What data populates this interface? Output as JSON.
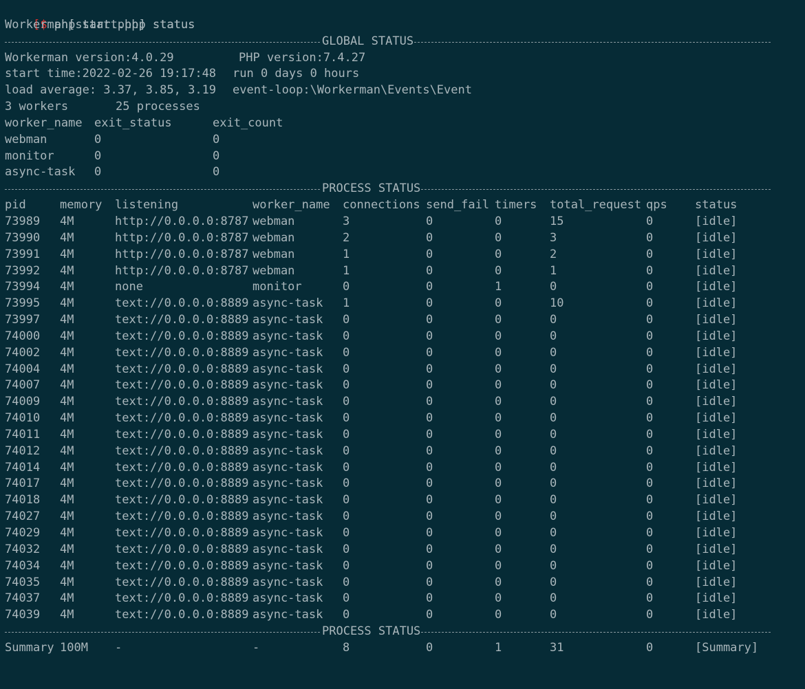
{
  "terminal": {
    "prompt_symbol": "$",
    "command": "php start.php status",
    "subtitle": "Workerman[start.php] status"
  },
  "global": {
    "section_title": "GLOBAL STATUS",
    "workerman_version": "Workerman version:4.0.29",
    "php_version": "PHP version:7.4.27",
    "start_time": "start time:2022-02-26 19:17:48",
    "run_time": "run 0 days 0 hours",
    "load_average": "load average: 3.37, 3.85, 3.19",
    "event_loop": "event-loop:\\Workerman\\Events\\Event",
    "workers": "3 workers",
    "processes": "25 processes",
    "worker_columns": [
      "worker_name",
      "exit_status",
      "exit_count"
    ],
    "worker_rows": [
      [
        "webman",
        "0",
        "0"
      ],
      [
        "monitor",
        "0",
        "0"
      ],
      [
        "async-task",
        "0",
        "0"
      ]
    ]
  },
  "process": {
    "section_title": "PROCESS STATUS",
    "columns": [
      "pid",
      "memory",
      "listening",
      "worker_name",
      "connections",
      "send_fail",
      "timers",
      "total_request",
      "qps",
      "status"
    ],
    "rows": [
      [
        "73989",
        "4M",
        "http://0.0.0.0:8787",
        "webman",
        "3",
        "0",
        "0",
        "15",
        "0",
        "[idle]"
      ],
      [
        "73990",
        "4M",
        "http://0.0.0.0:8787",
        "webman",
        "2",
        "0",
        "0",
        "3",
        "0",
        "[idle]"
      ],
      [
        "73991",
        "4M",
        "http://0.0.0.0:8787",
        "webman",
        "1",
        "0",
        "0",
        "2",
        "0",
        "[idle]"
      ],
      [
        "73992",
        "4M",
        "http://0.0.0.0:8787",
        "webman",
        "1",
        "0",
        "0",
        "1",
        "0",
        "[idle]"
      ],
      [
        "73994",
        "4M",
        "none",
        "monitor",
        "0",
        "0",
        "1",
        "0",
        "0",
        "[idle]"
      ],
      [
        "73995",
        "4M",
        "text://0.0.0.0:8889",
        "async-task",
        "1",
        "0",
        "0",
        "10",
        "0",
        "[idle]"
      ],
      [
        "73997",
        "4M",
        "text://0.0.0.0:8889",
        "async-task",
        "0",
        "0",
        "0",
        "0",
        "0",
        "[idle]"
      ],
      [
        "74000",
        "4M",
        "text://0.0.0.0:8889",
        "async-task",
        "0",
        "0",
        "0",
        "0",
        "0",
        "[idle]"
      ],
      [
        "74002",
        "4M",
        "text://0.0.0.0:8889",
        "async-task",
        "0",
        "0",
        "0",
        "0",
        "0",
        "[idle]"
      ],
      [
        "74004",
        "4M",
        "text://0.0.0.0:8889",
        "async-task",
        "0",
        "0",
        "0",
        "0",
        "0",
        "[idle]"
      ],
      [
        "74007",
        "4M",
        "text://0.0.0.0:8889",
        "async-task",
        "0",
        "0",
        "0",
        "0",
        "0",
        "[idle]"
      ],
      [
        "74009",
        "4M",
        "text://0.0.0.0:8889",
        "async-task",
        "0",
        "0",
        "0",
        "0",
        "0",
        "[idle]"
      ],
      [
        "74010",
        "4M",
        "text://0.0.0.0:8889",
        "async-task",
        "0",
        "0",
        "0",
        "0",
        "0",
        "[idle]"
      ],
      [
        "74011",
        "4M",
        "text://0.0.0.0:8889",
        "async-task",
        "0",
        "0",
        "0",
        "0",
        "0",
        "[idle]"
      ],
      [
        "74012",
        "4M",
        "text://0.0.0.0:8889",
        "async-task",
        "0",
        "0",
        "0",
        "0",
        "0",
        "[idle]"
      ],
      [
        "74014",
        "4M",
        "text://0.0.0.0:8889",
        "async-task",
        "0",
        "0",
        "0",
        "0",
        "0",
        "[idle]"
      ],
      [
        "74017",
        "4M",
        "text://0.0.0.0:8889",
        "async-task",
        "0",
        "0",
        "0",
        "0",
        "0",
        "[idle]"
      ],
      [
        "74018",
        "4M",
        "text://0.0.0.0:8889",
        "async-task",
        "0",
        "0",
        "0",
        "0",
        "0",
        "[idle]"
      ],
      [
        "74027",
        "4M",
        "text://0.0.0.0:8889",
        "async-task",
        "0",
        "0",
        "0",
        "0",
        "0",
        "[idle]"
      ],
      [
        "74029",
        "4M",
        "text://0.0.0.0:8889",
        "async-task",
        "0",
        "0",
        "0",
        "0",
        "0",
        "[idle]"
      ],
      [
        "74032",
        "4M",
        "text://0.0.0.0:8889",
        "async-task",
        "0",
        "0",
        "0",
        "0",
        "0",
        "[idle]"
      ],
      [
        "74034",
        "4M",
        "text://0.0.0.0:8889",
        "async-task",
        "0",
        "0",
        "0",
        "0",
        "0",
        "[idle]"
      ],
      [
        "74035",
        "4M",
        "text://0.0.0.0:8889",
        "async-task",
        "0",
        "0",
        "0",
        "0",
        "0",
        "[idle]"
      ],
      [
        "74037",
        "4M",
        "text://0.0.0.0:8889",
        "async-task",
        "0",
        "0",
        "0",
        "0",
        "0",
        "[idle]"
      ],
      [
        "74039",
        "4M",
        "text://0.0.0.0:8889",
        "async-task",
        "0",
        "0",
        "0",
        "0",
        "0",
        "[idle]"
      ]
    ],
    "summary": [
      "Summary",
      "100M",
      "-",
      "-",
      "8",
      "0",
      "1",
      "31",
      "0",
      "[Summary]"
    ]
  }
}
